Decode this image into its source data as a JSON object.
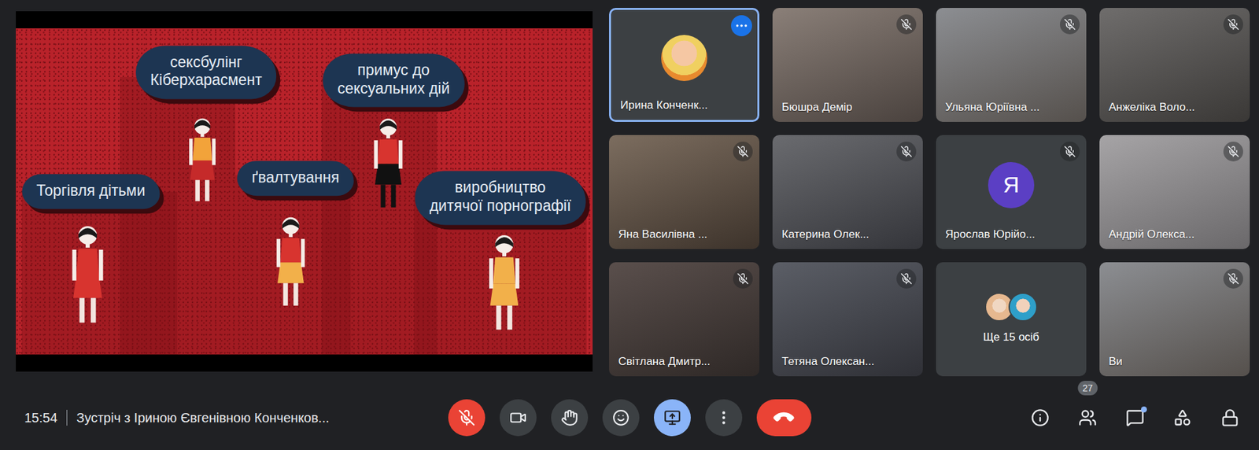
{
  "meeting": {
    "time": "15:54",
    "title": "Зустріч з Іриною Євгенівною Конченков..."
  },
  "presentation": {
    "labels": [
      "сексбулінг\nКіберхарасмент",
      "примус до\nсексуальних дій",
      "Торгівля дітьми",
      "ґвалтування",
      "виробництво\nдитячої порнографії"
    ]
  },
  "participants": [
    {
      "name": "Ирина Конченк...",
      "kind": "photo",
      "muted": false,
      "selected": true
    },
    {
      "name": "Бюшра Демір",
      "kind": "video",
      "muted": true,
      "selected": false
    },
    {
      "name": "Ульяна Юріївна ...",
      "kind": "video",
      "muted": true,
      "selected": false
    },
    {
      "name": "Анжеліка Воло...",
      "kind": "video",
      "muted": true,
      "selected": false
    },
    {
      "name": "Яна Василівна ...",
      "kind": "video",
      "muted": true,
      "selected": false
    },
    {
      "name": "Катерина Олек...",
      "kind": "video",
      "muted": true,
      "selected": false
    },
    {
      "name": "Ярослав Юрійо...",
      "kind": "letter",
      "letter": "Я",
      "muted": true,
      "selected": false
    },
    {
      "name": "Андрій Олекса...",
      "kind": "video",
      "muted": true,
      "selected": false
    },
    {
      "name": "Світлана Дмитр...",
      "kind": "video",
      "muted": true,
      "selected": false
    },
    {
      "name": "Тетяна Олексан...",
      "kind": "video",
      "muted": true,
      "selected": false
    },
    {
      "name": "Ще 15 осіб",
      "kind": "others",
      "muted": false,
      "selected": false
    },
    {
      "name": "Ви",
      "kind": "video",
      "muted": true,
      "selected": false
    }
  ],
  "controls": [
    {
      "kind": "mic",
      "on": false
    },
    {
      "kind": "camera",
      "on": true
    },
    {
      "kind": "hand",
      "on": false
    },
    {
      "kind": "emoji",
      "on": false
    },
    {
      "kind": "present",
      "on": true
    },
    {
      "kind": "more",
      "on": false
    },
    {
      "kind": "hangup",
      "on": false
    }
  ],
  "side_controls": [
    {
      "kind": "info"
    },
    {
      "kind": "people",
      "badge": "27"
    },
    {
      "kind": "chat",
      "unread": true
    },
    {
      "kind": "activities"
    },
    {
      "kind": "host"
    }
  ]
}
